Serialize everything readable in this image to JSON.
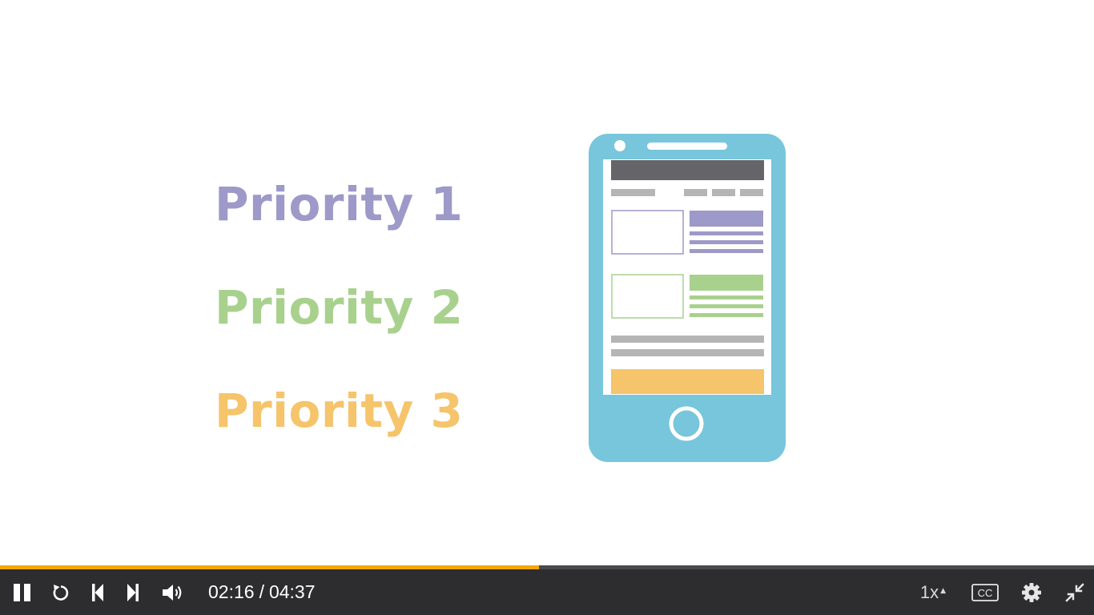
{
  "slide": {
    "priorities": [
      {
        "label": "Priority 1",
        "color": "#9d99c8"
      },
      {
        "label": "Priority 2",
        "color": "#a9d18e"
      },
      {
        "label": "Priority 3",
        "color": "#f5c46b"
      }
    ],
    "phone": {
      "body_color": "#77c6dc",
      "header_color": "#646469",
      "placeholder_color": "#b5b5b5",
      "block_1_color": "#9d99c8",
      "block_2_color": "#a9d18e",
      "footer_block_color": "#f5c46b"
    }
  },
  "player": {
    "progress": {
      "played_fraction": 0.493,
      "fill_color": "#f6a800"
    },
    "controls": {
      "pause_icon": "pause-icon",
      "replay_icon": "replay-icon",
      "previous_icon": "skip-previous-icon",
      "next_icon": "skip-next-icon",
      "volume_icon": "volume-icon",
      "current_time": "02:16",
      "separator": "/",
      "duration": "04:37",
      "speed": "1x",
      "captions_label": "CC",
      "settings_icon": "gear-icon",
      "exit_fullscreen_icon": "exit-fullscreen-icon"
    }
  }
}
